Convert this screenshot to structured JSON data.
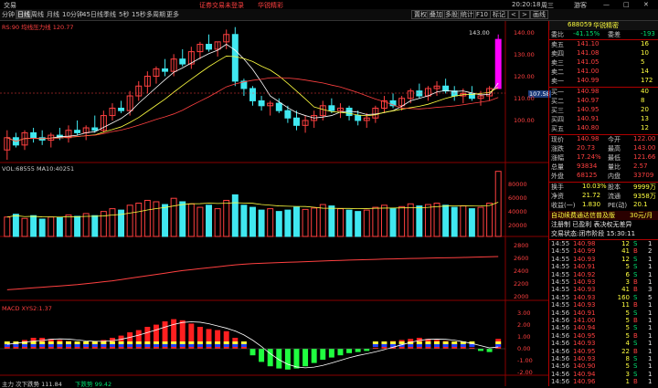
{
  "titlebar": {
    "menu_label": "交易",
    "login_status": "证券交易未登录",
    "app_name": "华锐精彩",
    "clock": "20:20:18",
    "weekday": "周三",
    "guest": "游客"
  },
  "toolbar": {
    "periods": [
      "分钟",
      "日线",
      "周线",
      "月线",
      "10分钟",
      "45日线",
      "季线",
      "5秒",
      "15秒",
      "多周期",
      "更多"
    ],
    "active_index": 1,
    "right_buttons": [
      "置权",
      "叠加",
      "多股",
      "统计",
      "F10",
      "标记",
      "<",
      ">",
      "画线"
    ]
  },
  "chart": {
    "main_label": "RS:90 均线压力线 120.77",
    "price_tag": "143.00",
    "current_price": "107.58",
    "price_axis": [
      "140.00",
      "130.00",
      "120.00",
      "110.00",
      "100.00"
    ],
    "vol_label": "VOL:68555 MA10:40251",
    "vol_axis": [
      "80000",
      "60000",
      "40000",
      "20000"
    ],
    "line_axis": [
      "2800",
      "2600",
      "2400",
      "2200",
      "2000"
    ],
    "macd_label": "MACD XYS2:1.37",
    "macd_axis": [
      "3.00",
      "2.00",
      "1.00",
      "0.00",
      "-1.00",
      "-2.00"
    ],
    "bottom_label_1": "主力 次下跌势 111.84",
    "bottom_label_2": "下跌势 99.42"
  },
  "panel": {
    "code": "688059",
    "name": "华锐精密",
    "weibi_label": "委比",
    "weibi_value": "-41.15%",
    "weicha_label": "委差",
    "weicha_value": "-193",
    "asks": [
      {
        "label": "卖五",
        "price": "141.10",
        "vol": "16"
      },
      {
        "label": "卖四",
        "price": "141.08",
        "vol": "10"
      },
      {
        "label": "卖三",
        "price": "141.05",
        "vol": "5"
      },
      {
        "label": "卖二",
        "price": "141.00",
        "vol": "14"
      },
      {
        "label": "卖一",
        "price": "140.99",
        "vol": "172"
      }
    ],
    "bids": [
      {
        "label": "买一",
        "price": "140.98",
        "vol": "40"
      },
      {
        "label": "买二",
        "price": "140.97",
        "vol": "8"
      },
      {
        "label": "买三",
        "price": "140.95",
        "vol": "20"
      },
      {
        "label": "买四",
        "price": "140.91",
        "vol": "13"
      },
      {
        "label": "买五",
        "price": "140.80",
        "vol": "12"
      }
    ],
    "stats": [
      {
        "l1": "现价",
        "v1": "140.98",
        "l2": "今开",
        "v2": "122.00"
      },
      {
        "l1": "涨跌",
        "v1": "20.73",
        "l2": "最高",
        "v2": "143.00"
      },
      {
        "l1": "涨幅",
        "v1": "17.24%",
        "l2": "最低",
        "v2": "121.66"
      },
      {
        "l1": "总量",
        "v1": "93834",
        "l2": "量比",
        "v2": "2.57"
      },
      {
        "l1": "外盘",
        "v1": "68125",
        "l2": "内盘",
        "v2": "33709"
      }
    ],
    "stats2": [
      {
        "l1": "换手",
        "v1": "10.03%",
        "l2": "股本",
        "v2": "9999万"
      },
      {
        "l1": "净资",
        "v1": "21.72",
        "l2": "流通",
        "v2": "9358万"
      },
      {
        "l1": "收益(一)",
        "v1": "1.830",
        "l2": "PE(动)",
        "v2": "20.1"
      }
    ],
    "notice1": "自动续费通达信普及版",
    "notice1_price": "30元/月",
    "notice2": "注册制 已盈利 表决权无差异",
    "notice3": "交易状态:闭市阶段 15:30:11",
    "ticks": [
      {
        "t": "14:55",
        "p": "140.98",
        "v": "12",
        "d": "S",
        "n": "1"
      },
      {
        "t": "14:55",
        "p": "140.99",
        "v": "41",
        "d": "B",
        "n": "2"
      },
      {
        "t": "14:55",
        "p": "140.93",
        "v": "12",
        "d": "S",
        "n": "1"
      },
      {
        "t": "14:55",
        "p": "140.91",
        "v": "5",
        "d": "S",
        "n": "1"
      },
      {
        "t": "14:55",
        "p": "140.92",
        "v": "6",
        "d": "S",
        "n": "1"
      },
      {
        "t": "14:55",
        "p": "140.93",
        "v": "3",
        "d": "B",
        "n": "1"
      },
      {
        "t": "14:55",
        "p": "140.93",
        "v": "41",
        "d": "B",
        "n": "3"
      },
      {
        "t": "14:55",
        "p": "140.93",
        "v": "160",
        "d": "S",
        "n": "5"
      },
      {
        "t": "14:55",
        "p": "140.93",
        "v": "11",
        "d": "B",
        "n": "1"
      },
      {
        "t": "14:56",
        "p": "140.91",
        "v": "5",
        "d": "S",
        "n": "1"
      },
      {
        "t": "14:56",
        "p": "141.00",
        "v": "5",
        "d": "B",
        "n": "1"
      },
      {
        "t": "14:56",
        "p": "140.94",
        "v": "5",
        "d": "S",
        "n": "1"
      },
      {
        "t": "14:56",
        "p": "140.95",
        "v": "5",
        "d": "B",
        "n": "1"
      },
      {
        "t": "14:56",
        "p": "140.93",
        "v": "4",
        "d": "S",
        "n": "1"
      },
      {
        "t": "14:56",
        "p": "140.95",
        "v": "22",
        "d": "B",
        "n": "1"
      },
      {
        "t": "14:56",
        "p": "140.93",
        "v": "8",
        "d": "S",
        "n": "1"
      },
      {
        "t": "14:56",
        "p": "140.90",
        "v": "5",
        "d": "S",
        "n": "1"
      },
      {
        "t": "14:56",
        "p": "140.94",
        "v": "3",
        "d": "S",
        "n": "1"
      },
      {
        "t": "14:56",
        "p": "140.96",
        "v": "1",
        "d": "B",
        "n": "1"
      }
    ]
  },
  "chart_data": {
    "type": "candlestick",
    "note_vol_series": "volume",
    "candles": [
      [
        96,
        104,
        92,
        101
      ],
      [
        101,
        103,
        97,
        98
      ],
      [
        98,
        104,
        96,
        103
      ],
      [
        103,
        105,
        99,
        101
      ],
      [
        101,
        104,
        98,
        100
      ],
      [
        100,
        103,
        97,
        102
      ],
      [
        102,
        105,
        100,
        101
      ],
      [
        101,
        106,
        99,
        104
      ],
      [
        104,
        108,
        102,
        103
      ],
      [
        103,
        106,
        100,
        105
      ],
      [
        105,
        110,
        103,
        104
      ],
      [
        104,
        112,
        103,
        110
      ],
      [
        110,
        115,
        108,
        113
      ],
      [
        113,
        116,
        111,
        112
      ],
      [
        112,
        120,
        110,
        118
      ],
      [
        118,
        124,
        116,
        122
      ],
      [
        122,
        128,
        119,
        126
      ],
      [
        126,
        130,
        123,
        129
      ],
      [
        129,
        133,
        126,
        128
      ],
      [
        128,
        135,
        126,
        133
      ],
      [
        133,
        137,
        130,
        131
      ],
      [
        131,
        138,
        129,
        136
      ],
      [
        136,
        140,
        133,
        139
      ],
      [
        139,
        143,
        136,
        137
      ],
      [
        137,
        140,
        134,
        140
      ],
      [
        140,
        145,
        137,
        143
      ],
      [
        143,
        146,
        122,
        124
      ],
      [
        124,
        125,
        118,
        121
      ],
      [
        121,
        122,
        114,
        116
      ],
      [
        116,
        118,
        112,
        114
      ],
      [
        114,
        116,
        110,
        115
      ],
      [
        115,
        117,
        111,
        112
      ],
      [
        112,
        114,
        107,
        109
      ],
      [
        109,
        112,
        104,
        106
      ],
      [
        106,
        110,
        103,
        108
      ],
      [
        108,
        112,
        105,
        110
      ],
      [
        110,
        116,
        108,
        114
      ],
      [
        114,
        117,
        111,
        112
      ],
      [
        112,
        115,
        109,
        113
      ],
      [
        113,
        114,
        108,
        110
      ],
      [
        110,
        112,
        106,
        108
      ],
      [
        108,
        111,
        105,
        109
      ],
      [
        109,
        114,
        107,
        113
      ],
      [
        113,
        118,
        111,
        116
      ],
      [
        116,
        119,
        113,
        114
      ],
      [
        114,
        118,
        112,
        117
      ],
      [
        117,
        121,
        115,
        120
      ],
      [
        120,
        123,
        117,
        118
      ],
      [
        118,
        122,
        116,
        121
      ],
      [
        121,
        124,
        118,
        122
      ],
      [
        122,
        125,
        119,
        120
      ],
      [
        120,
        122,
        116,
        118
      ],
      [
        118,
        121,
        115,
        119
      ],
      [
        119,
        122,
        116,
        117
      ],
      [
        117,
        120,
        114,
        118
      ],
      [
        118,
        122,
        116,
        121
      ],
      [
        121,
        143,
        121,
        141
      ]
    ],
    "volume": [
      28000,
      32000,
      26000,
      30000,
      25000,
      28000,
      27000,
      31000,
      29000,
      33000,
      30000,
      36000,
      40000,
      38000,
      45000,
      48000,
      52000,
      50000,
      46000,
      55000,
      50000,
      47000,
      42000,
      45000,
      40000,
      52000,
      60000,
      45000,
      42000,
      38000,
      40000,
      36000,
      38000,
      42000,
      39000,
      41000,
      46000,
      44000,
      40000,
      38000,
      36000,
      38000,
      42000,
      45000,
      40000,
      43000,
      47000,
      44000,
      46000,
      48000,
      45000,
      42000,
      44000,
      40000,
      42000,
      48000,
      93834
    ],
    "line2": [
      2080,
      2090,
      2100,
      2110,
      2120,
      2130,
      2140,
      2150,
      2160,
      2175,
      2190,
      2205,
      2220,
      2240,
      2260,
      2280,
      2300,
      2320,
      2340,
      2360,
      2380,
      2395,
      2410,
      2425,
      2440,
      2455,
      2470,
      2480,
      2490,
      2495,
      2500,
      2505,
      2510,
      2515,
      2520,
      2525,
      2530,
      2535,
      2540,
      2545,
      2548,
      2552,
      2556,
      2560,
      2563,
      2566,
      2569,
      2572,
      2575,
      2578,
      2580,
      2583,
      2586,
      2589,
      2592,
      2596,
      2600
    ],
    "macd": [
      0.4,
      0.6,
      0.8,
      1.0,
      1.0,
      0.9,
      0.8,
      0.7,
      0.6,
      0.6,
      0.7,
      0.8,
      1.0,
      1.2,
      1.5,
      1.7,
      2.0,
      2.2,
      2.5,
      2.7,
      2.6,
      2.3,
      2.0,
      1.8,
      1.7,
      1.6,
      1.0,
      0.2,
      -0.6,
      -1.2,
      -1.6,
      -1.8,
      -1.9,
      -1.8,
      -1.6,
      -1.3,
      -1.0,
      -0.8,
      -0.6,
      -0.4,
      -0.3,
      -0.2,
      0.1,
      0.4,
      0.7,
      0.8,
      0.9,
      1.0,
      0.9,
      0.8,
      0.7,
      0.5,
      0.3,
      0.1,
      -0.2,
      -0.3,
      0.9
    ]
  }
}
